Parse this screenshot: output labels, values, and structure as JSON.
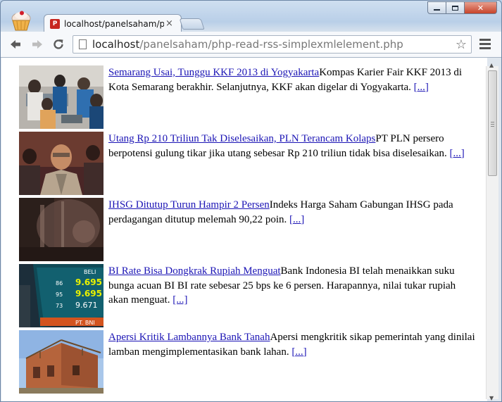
{
  "browser": {
    "tab_title": "localhost/panelsaham/ph",
    "tab_close": "×",
    "favicon_letter": "P",
    "url_host": "localhost",
    "url_path": "/panelsaham/php-read-rss-simplexmlelement.php"
  },
  "articles": [
    {
      "title": "Semarang Usai, Tunggu KKF 2013 di Yogyakarta",
      "description": "Kompas Karier Fair KKF 2013 di Kota Semarang berakhir. Selanjutnya, KKF akan digelar di Yogyakarta.",
      "more": "[...]"
    },
    {
      "title": "Utang Rp 210 Triliun Tak Diselesaikan, PLN Terancam Kolaps",
      "description": "PT PLN persero berpotensi gulung tikar jika utang sebesar Rp 210 triliun tidak bisa diselesaikan.",
      "more": "[...]"
    },
    {
      "title": "IHSG Ditutup Turun Hampir 2 Persen",
      "description": "Indeks Harga Saham Gabungan IHSG pada perdagangan ditutup melemah 90,22 poin.",
      "more": "[...]"
    },
    {
      "title": "BI Rate Bisa Dongkrak Rupiah Menguat",
      "description": "Bank Indonesia BI telah menaikkan suku bunga acuan BI BI rate sebesar 25 bps ke 6 persen. Harapannya, nilai tukar rupiah akan menguat.",
      "more": "[...]"
    },
    {
      "title": "Apersi Kritik Lambannya Bank Tanah",
      "description": "Apersi mengkritik sikap pemerintah yang dinilai lamban mengimplementasikan bank lahan.",
      "more": "[...]"
    }
  ],
  "ticker_board": {
    "header": "BELI",
    "values": [
      "9.695",
      "9.695",
      "9.671"
    ],
    "small_values": [
      "86",
      "95",
      "73"
    ],
    "sign": "PT. BNI"
  }
}
